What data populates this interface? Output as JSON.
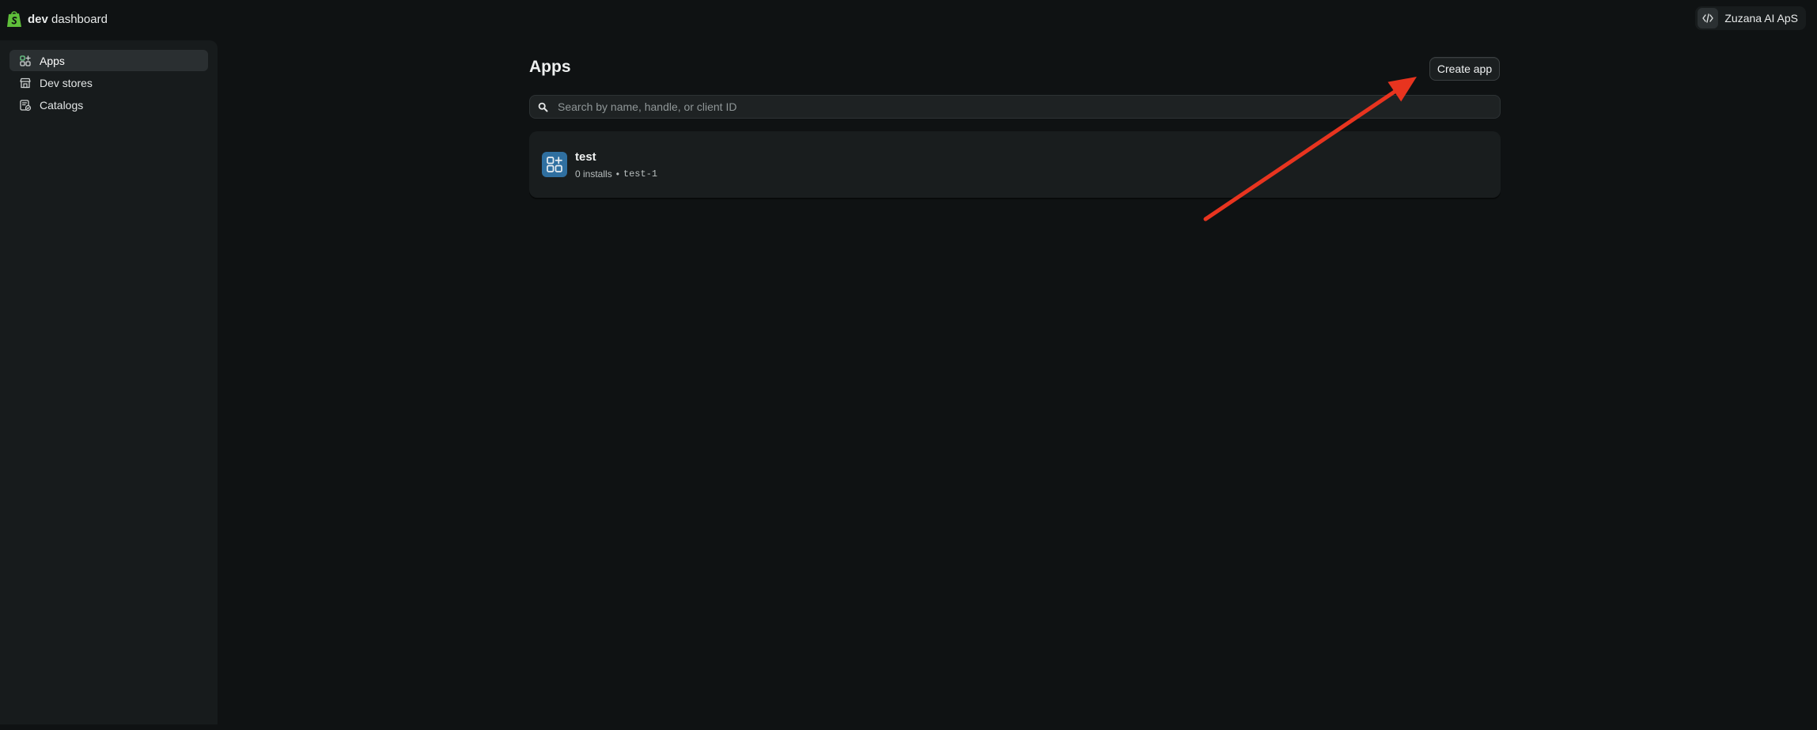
{
  "header": {
    "brand_bold": "dev",
    "brand_rest": " dashboard",
    "org_name": "Zuzana AI ApS",
    "org_icon": "code-icon"
  },
  "sidebar": {
    "items": [
      {
        "label": "Apps",
        "icon": "apps-icon",
        "active": true
      },
      {
        "label": "Dev stores",
        "icon": "store-icon",
        "active": false
      },
      {
        "label": "Catalogs",
        "icon": "catalog-icon",
        "active": false
      }
    ]
  },
  "main": {
    "title": "Apps",
    "create_button": "Create app",
    "search": {
      "placeholder": "Search by name, handle, or client ID",
      "value": ""
    },
    "apps": [
      {
        "name": "test",
        "installs": "0 installs",
        "separator": "•",
        "handle": "test-1",
        "icon": "app-grid-icon"
      }
    ]
  },
  "annotation": {
    "arrow_color": "#e8341f"
  },
  "colors": {
    "brand_green": "#5fbf3a",
    "background": "#0f1213",
    "sidebar": "#171b1c",
    "app_icon": "#2f6fa0"
  }
}
